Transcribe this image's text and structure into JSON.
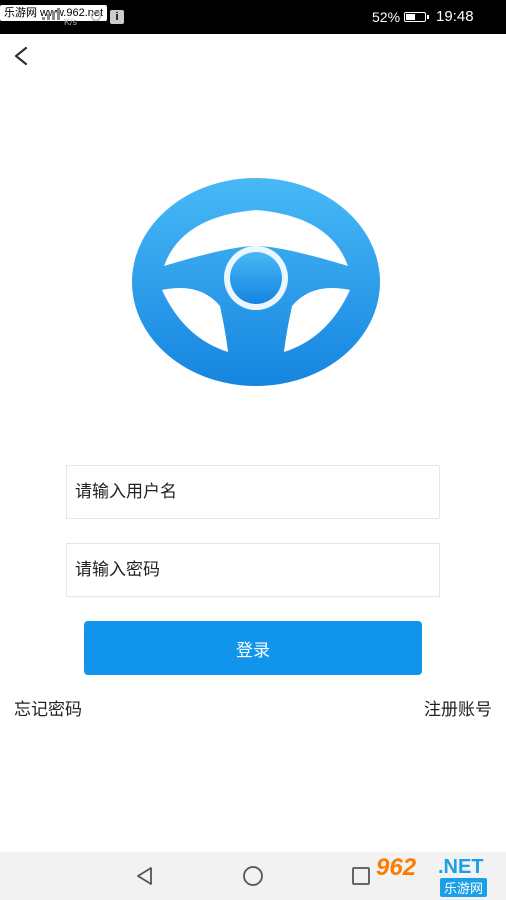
{
  "status_bar": {
    "watermark": "乐游网 www.962.net",
    "speed_unit": "K/s",
    "info_icon": "info-icon",
    "battery_percent": "52%",
    "battery_level": 0.52,
    "time": "19:48"
  },
  "header": {
    "back_icon": "chevron-left-icon"
  },
  "logo": {
    "icon": "steering-wheel-icon",
    "color": "#1f9bea"
  },
  "form": {
    "username_placeholder": "请输入用户名",
    "password_placeholder": "请输入密码",
    "login_label": "登录",
    "forgot_password_label": "忘记密码",
    "register_label": "注册账号",
    "button_color": "#1194ec"
  },
  "nav_bar": {
    "back_icon": "triangle-back-icon",
    "home_icon": "circle-home-icon",
    "recent_icon": "square-recent-icon"
  },
  "watermark_bottom": {
    "number": "962",
    "domain": ".NET",
    "brand": "乐游网"
  }
}
